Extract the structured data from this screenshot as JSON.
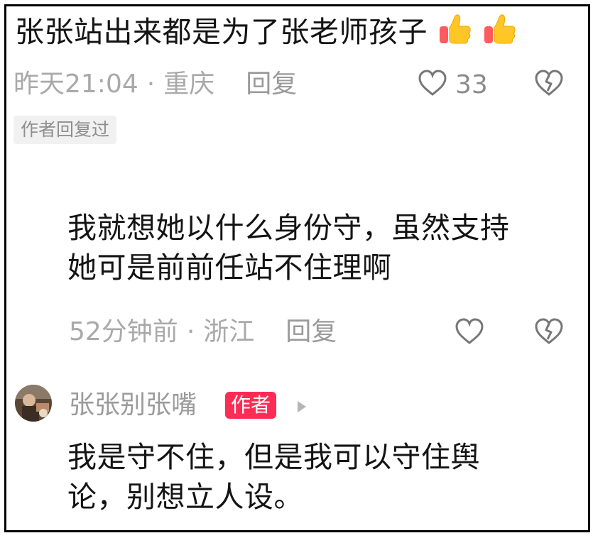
{
  "top_comment": {
    "text": "张张站出来都是为了张老师孩子",
    "emoji": [
      "thumbs-up",
      "thumbs-up"
    ],
    "time": "昨天21:04",
    "separator": "·",
    "location": "重庆",
    "reply_label": "回复",
    "like_count": "33",
    "author_replied_tag": "作者回复过"
  },
  "reply_1": {
    "line1": "我就想她以什么身份守，虽然支持",
    "line2": "她可是前前任站不住理啊",
    "time": "52分钟前",
    "separator": "·",
    "location": "浙江",
    "reply_label": "回复"
  },
  "author_reply": {
    "name": "张张别张嘴",
    "badge": "作者",
    "line1": "我是守不住，但是我可以守住舆",
    "line2": "论，别想立人设。"
  },
  "colors": {
    "badge_red": "#fe2c55",
    "meta_gray": "#a9a9a9",
    "text_black": "#141414"
  }
}
